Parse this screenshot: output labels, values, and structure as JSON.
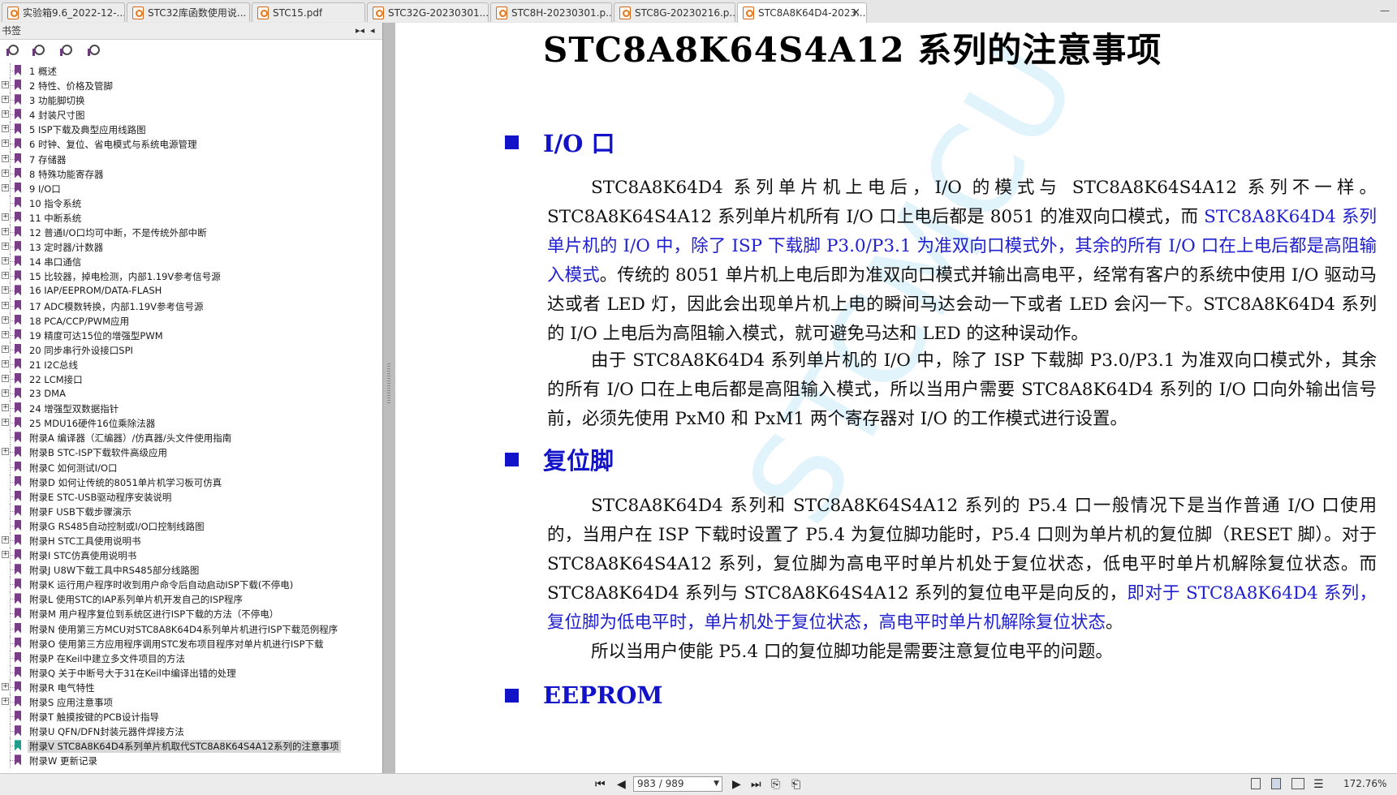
{
  "tabs": [
    {
      "label": "实验箱9.6_2022-12-...",
      "active": false
    },
    {
      "label": "STC32库函数使用说...",
      "active": false
    },
    {
      "label": "STC15.pdf",
      "active": false
    },
    {
      "label": "STC32G-20230301....",
      "active": false
    },
    {
      "label": "STC8H-20230301.p...",
      "active": false
    },
    {
      "label": "STC8G-20230216.p...",
      "active": false
    },
    {
      "label": "STC8A8K64D4-2023...",
      "active": true
    }
  ],
  "tab_close": "×",
  "bookmark_pane": {
    "title": "书签",
    "bookmarks": [
      {
        "label": "1 概述",
        "expandable": false
      },
      {
        "label": "2 特性、价格及管脚",
        "expandable": true
      },
      {
        "label": "3 功能脚切换",
        "expandable": true
      },
      {
        "label": "4 封装尺寸图",
        "expandable": true
      },
      {
        "label": "5 ISP下载及典型应用线路图",
        "expandable": true
      },
      {
        "label": "6 时钟、复位、省电模式与系统电源管理",
        "expandable": true
      },
      {
        "label": "7 存储器",
        "expandable": true
      },
      {
        "label": "8 特殊功能寄存器",
        "expandable": true
      },
      {
        "label": "9 I/O口",
        "expandable": true
      },
      {
        "label": "10 指令系统",
        "expandable": false
      },
      {
        "label": "11 中断系统",
        "expandable": true
      },
      {
        "label": "12 普通I/O口均可中断，不是传统外部中断",
        "expandable": true
      },
      {
        "label": "13 定时器/计数器",
        "expandable": true
      },
      {
        "label": "14 串口通信",
        "expandable": true
      },
      {
        "label": "15 比较器，掉电检测，内部1.19V参考信号源",
        "expandable": true
      },
      {
        "label": "16 IAP/EEPROM/DATA-FLASH",
        "expandable": true
      },
      {
        "label": "17 ADC模数转换，内部1.19V参考信号源",
        "expandable": true
      },
      {
        "label": "18 PCA/CCP/PWM应用",
        "expandable": true
      },
      {
        "label": "19 精度可达15位的增强型PWM",
        "expandable": true
      },
      {
        "label": "20 同步串行外设接口SPI",
        "expandable": true
      },
      {
        "label": "21 I2C总线",
        "expandable": true
      },
      {
        "label": "22 LCM接口",
        "expandable": true
      },
      {
        "label": "23 DMA",
        "expandable": true
      },
      {
        "label": "24 增强型双数据指针",
        "expandable": true
      },
      {
        "label": "25 MDU16硬件16位乘除法器",
        "expandable": true
      },
      {
        "label": "附录A 编译器（汇编器）/仿真器/头文件使用指南",
        "expandable": false
      },
      {
        "label": "附录B STC-ISP下载软件高级应用",
        "expandable": true
      },
      {
        "label": "附录C 如何测试I/O口",
        "expandable": false
      },
      {
        "label": "附录D 如何让传统的8051单片机学习板可仿真",
        "expandable": false
      },
      {
        "label": "附录E STC-USB驱动程序安装说明",
        "expandable": false
      },
      {
        "label": "附录F USB下载步骤演示",
        "expandable": false
      },
      {
        "label": "附录G RS485自动控制或I/O口控制线路图",
        "expandable": false
      },
      {
        "label": "附录H STC工具使用说明书",
        "expandable": true
      },
      {
        "label": "附录I STC仿真使用说明书",
        "expandable": true
      },
      {
        "label": "附录J U8W下载工具中RS485部分线路图",
        "expandable": false
      },
      {
        "label": "附录K 运行用户程序时收到用户命令后自动启动ISP下载(不停电)",
        "expandable": false
      },
      {
        "label": "附录L 使用STC的IAP系列单片机开发自己的ISP程序",
        "expandable": false
      },
      {
        "label": "附录M 用户程序复位到系统区进行ISP下载的方法（不停电）",
        "expandable": false
      },
      {
        "label": "附录N 使用第三方MCU对STC8A8K64D4系列单片机进行ISP下载范例程序",
        "expandable": false
      },
      {
        "label": "附录O 使用第三方应用程序调用STC发布项目程序对单片机进行ISP下载",
        "expandable": false
      },
      {
        "label": "附录P 在Keil中建立多文件项目的方法",
        "expandable": false
      },
      {
        "label": "附录Q 关于中断号大于31在Keil中编译出错的处理",
        "expandable": false
      },
      {
        "label": "附录R 电气特性",
        "expandable": true
      },
      {
        "label": "附录S 应用注意事项",
        "expandable": true
      },
      {
        "label": "附录T 触摸按键的PCB设计指导",
        "expandable": false
      },
      {
        "label": "附录U QFN/DFN封装元器件焊接方法",
        "expandable": false
      },
      {
        "label": "附录V STC8A8K64D4系列单片机取代STC8A8K64S4A12系列的注意事项",
        "expandable": false,
        "selected": true
      },
      {
        "label": "附录W 更新记录",
        "expandable": false
      }
    ]
  },
  "document": {
    "title": "STC8A8K64S4A12 系列的注意事项",
    "watermark": "STCMCU",
    "sections": [
      {
        "heading": "I/O 口",
        "paragraphs": [
          [
            {
              "text": "STC8A8K64D4 系列单片机上电后，I/O 的模式与 STC8A8K64S4A12 系列不一样。STC8A8K64S4A12 系列单片机所有 I/O 口上电后都是 8051 的准双向口模式，而 ",
              "hl": false
            },
            {
              "text": "STC8A8K64D4 系列单片机的 I/O 中，除了 ISP 下载脚 P3.0/P3.1 为准双向口模式外，其余的所有 I/O 口在上电后都是高阻输入模式",
              "hl": true
            },
            {
              "text": "。传统的 8051 单片机上电后即为准双向口模式并输出高电平，经常有客户的系统中使用 I/O 驱动马达或者 LED 灯，因此会出现单片机上电的瞬间马达会动一下或者 LED 会闪一下。STC8A8K64D4 系列的 I/O 上电后为高阻输入模式，就可避免马达和 LED 的这种误动作。",
              "hl": false
            }
          ],
          [
            {
              "text": "由于 STC8A8K64D4 系列单片机的 I/O 中，除了 ISP 下载脚 P3.0/P3.1 为准双向口模式外，其余的所有 I/O 口在上电后都是高阻输入模式，所以当用户需要 STC8A8K64D4 系列的 I/O 口向外输出信号前，必须先使用 PxM0 和 PxM1 两个寄存器对 I/O 的工作模式进行设置。",
              "hl": false
            }
          ]
        ]
      },
      {
        "heading": "复位脚",
        "paragraphs": [
          [
            {
              "text": "STC8A8K64D4 系列和 STC8A8K64S4A12 系列的 P5.4 口一般情况下是当作普通 I/O 口使用的，当用户在 ISP 下载时设置了 P5.4 为复位脚功能时，P5.4 口则为单片机的复位脚（RESET 脚）。对于 STC8A8K64S4A12 系列，复位脚为高电平时单片机处于复位状态，低电平时单片机解除复位状态。而 STC8A8K64D4 系列与 STC8A8K64S4A12 系列的复位电平是向反的，",
              "hl": false
            },
            {
              "text": "即对于 STC8A8K64D4 系列，复位脚为低电平时，单片机处于复位状态，高电平时单片机解除复位状态",
              "hl": true
            },
            {
              "text": "。",
              "hl": false
            }
          ],
          [
            {
              "text": "所以当用户使能 P5.4 口的复位脚功能是需要注意复位电平的问题。",
              "hl": false
            }
          ]
        ]
      },
      {
        "heading": "EEPROM",
        "paragraphs": []
      }
    ]
  },
  "statusbar": {
    "page_value": "983 / 989",
    "zoom": "172.76%"
  },
  "colors": {
    "accent_blue": "#1212c8",
    "selected_bookmark": "#1f9e8e",
    "bookmark_icon": "#7a3d88"
  }
}
